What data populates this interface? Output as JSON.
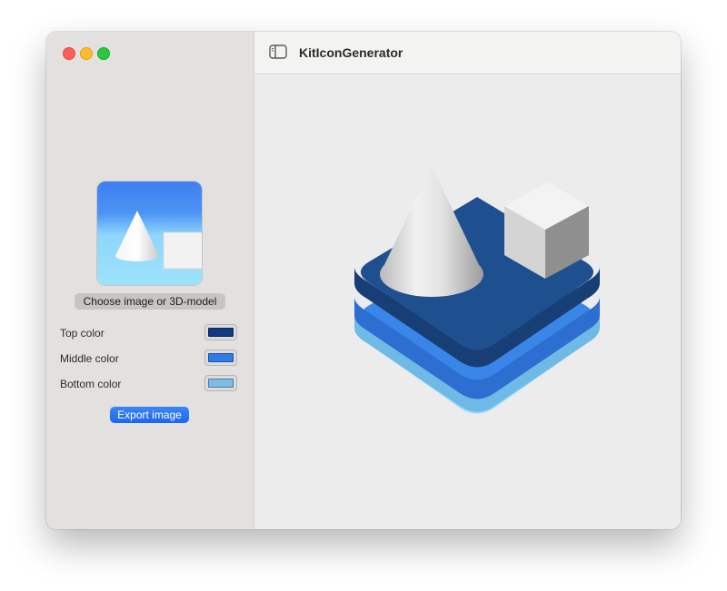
{
  "window": {
    "title": "KitIconGenerator"
  },
  "sidebar": {
    "choose_button_label": "Choose image or 3D-model",
    "colors": [
      {
        "label": "Top color",
        "value": "#123a82"
      },
      {
        "label": "Middle color",
        "value": "#2f7ce6"
      },
      {
        "label": "Bottom color",
        "value": "#7cbde8"
      }
    ],
    "export_button_label": "Export image"
  },
  "icons": {
    "sidebar_toggle": "sidebar-toggle-icon",
    "cone": "cone-shape",
    "cube": "cube-shape"
  },
  "theme": {
    "accent": "#1f6bee",
    "layer_top": "#1e4f8e",
    "layer_middle": "#3a86e8",
    "layer_bottom": "#8fd4f8"
  }
}
